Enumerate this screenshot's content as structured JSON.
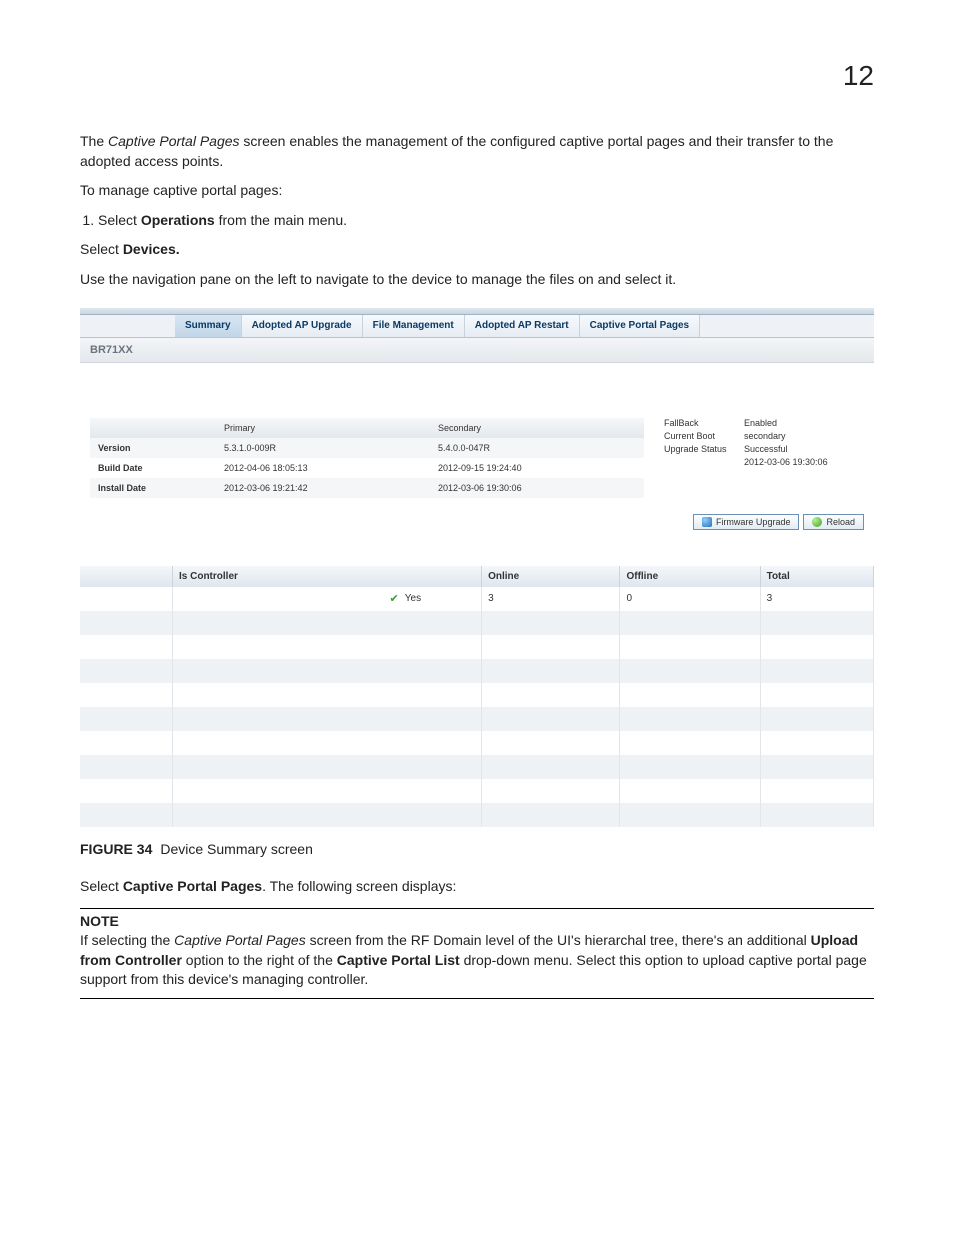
{
  "page_number": "12",
  "intro1_pre": "The ",
  "intro1_em": "Captive Portal Pages",
  "intro1_post": " screen enables the management of the configured captive portal pages and their transfer to the adopted access points.",
  "intro2": "To manage captive portal pages:",
  "step1_pre": "Select ",
  "step1_bold": "Operations",
  "step1_post": " from the main menu.",
  "select_devices_pre": "Select ",
  "select_devices_bold": "Devices.",
  "navinstr": "Use the navigation pane on the left to navigate to the device to manage the files on and select it.",
  "tabs": {
    "summary": "Summary",
    "adopted_upgrade": "Adopted AP Upgrade",
    "file_mgmt": "File Management",
    "adopted_restart": "Adopted AP Restart",
    "captive": "Captive Portal Pages"
  },
  "device_id": "BR71XX",
  "ver": {
    "hdr_primary": "Primary",
    "hdr_secondary": "Secondary",
    "row_version": "Version",
    "row_build": "Build Date",
    "row_install": "Install Date",
    "p_version": "5.3.1.0-009R",
    "s_version": "5.4.0.0-047R",
    "p_build": "2012-04-06 18:05:13",
    "s_build": "2012-09-15 19:24:40",
    "p_install": "2012-03-06 19:21:42",
    "s_install": "2012-03-06 19:30:06"
  },
  "status": {
    "fallback_l": "FallBack",
    "fallback_v": "Enabled",
    "boot_l": "Current Boot",
    "boot_v": "secondary",
    "upg_l": "Upgrade Status",
    "upg_v": "Successful",
    "upg_ts": "2012-03-06 19:30:06"
  },
  "btn_firmware": "Firmware Upgrade",
  "btn_reload": "Reload",
  "grid": {
    "h_isc": "Is Controller",
    "h_online": "Online",
    "h_offline": "Offline",
    "h_total": "Total",
    "row1_isc": "Yes",
    "row1_online": "3",
    "row1_offline": "0",
    "row1_total": "3"
  },
  "fig_label": "FIGURE 34",
  "fig_caption": "Device Summary screen",
  "post_fig_pre": "Select ",
  "post_fig_bold": "Captive Portal Pages",
  "post_fig_post": ". The following screen displays:",
  "note_title": "NOTE",
  "note_pre": "If selecting the ",
  "note_em": "Captive Portal Pages",
  "note_mid1": " screen from the RF Domain level of the UI's hierarchal tree, there's an additional ",
  "note_b1": "Upload from Controller",
  "note_mid2": " option to the right of the ",
  "note_b2": "Captive Portal List",
  "note_post": " drop-down menu. Select this option to upload captive portal page support from this device's managing controller."
}
